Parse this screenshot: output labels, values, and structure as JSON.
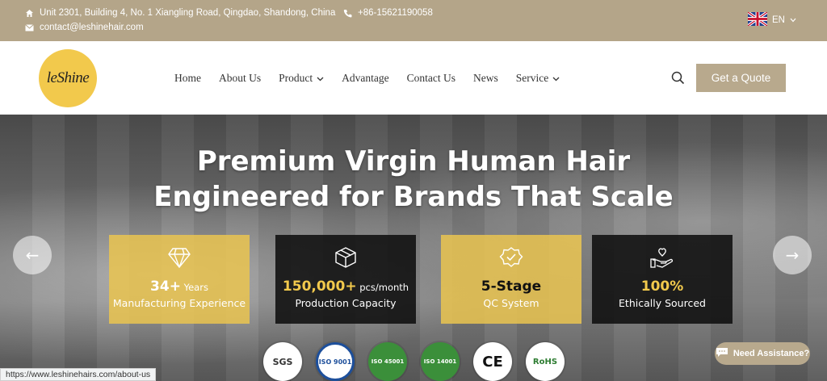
{
  "topbar": {
    "address": "Unit 2301, Building 4, No. 1 Xiangling Road, Qingdao, Shandong, China",
    "phone": "+86-15621190058",
    "email": "contact@leshinehair.com",
    "language": "EN"
  },
  "nav": {
    "logo_text": "leShine",
    "items": [
      "Home",
      "About Us",
      "Product",
      "Advantage",
      "Contact Us",
      "News",
      "Service"
    ],
    "cta": "Get a Quote"
  },
  "hero": {
    "headline_1": "Premium Virgin Human Hair",
    "headline_2": "Engineered for Brands That Scale",
    "stats": [
      {
        "value": "34+",
        "unit": "Years",
        "label": "Manufacturing Experience",
        "icon": "diamond-icon"
      },
      {
        "value": "150,000+",
        "unit": "pcs/month",
        "label": "Production Capacity",
        "icon": "box-icon"
      },
      {
        "value": "5-Stage",
        "unit": "",
        "label": "QC System",
        "icon": "badge-check-icon"
      },
      {
        "value": "100%",
        "unit": "",
        "label": "Ethically Sourced",
        "icon": "hand-heart-icon"
      }
    ],
    "certs": [
      "SGS",
      "ISO 9001",
      "ISO 45001",
      "ISO 14001",
      "CE",
      "RoHS"
    ]
  },
  "assist": "Need Assistance?",
  "status_url": "https://www.leshinehairs.com/about-us",
  "colors": {
    "topbar": "#b4a589",
    "gold": "#eac450",
    "accent": "#f2c94c"
  }
}
